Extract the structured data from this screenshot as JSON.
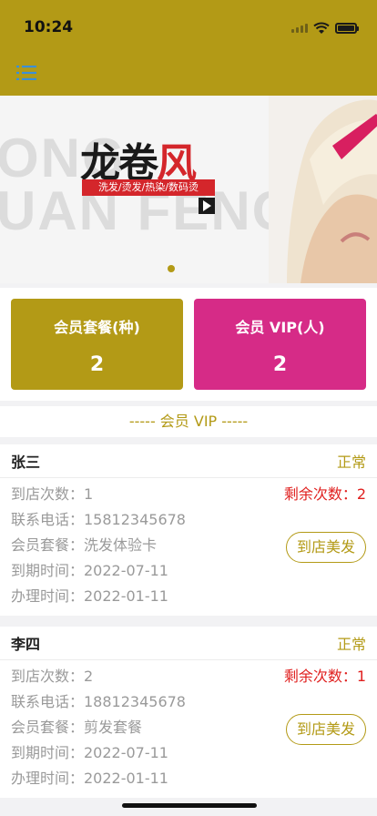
{
  "status_bar": {
    "time": "10:24"
  },
  "banner": {
    "bg_text_line1": "ONG",
    "bg_text_line2": "UAN FENG",
    "logo_black": "龙卷",
    "logo_red": "风",
    "tagline": "洗发/烫发/热染/数码烫"
  },
  "stats": [
    {
      "label": "会员套餐(种)",
      "value": "2",
      "color": "#b39a16"
    },
    {
      "label": "会员 VIP(人)",
      "value": "2",
      "color": "#d62b87"
    }
  ],
  "section_title": "----- 会员 VIP -----",
  "members": [
    {
      "name": "张三",
      "status": "正常",
      "visits": "到店次数：1",
      "phone": "联系电话：15812345678",
      "package": "会员套餐：洗发体验卡",
      "expire": "到期时间：2022-07-11",
      "created": "办理时间：2022-01-11",
      "remaining": "剩余次数：2",
      "action": "到店美发"
    },
    {
      "name": "李四",
      "status": "正常",
      "visits": "到店次数：2",
      "phone": "联系电话：18812345678",
      "package": "会员套餐：剪发套餐",
      "expire": "到期时间：2022-07-11",
      "created": "办理时间：2022-01-11",
      "remaining": "剩余次数：1",
      "action": "到店美发"
    }
  ],
  "colors": {
    "accent": "#b39a16",
    "pink": "#d62b87",
    "red": "#e0201f"
  },
  "icons": [
    "signal-icon",
    "wifi-icon",
    "battery-icon",
    "menu-list-icon"
  ]
}
